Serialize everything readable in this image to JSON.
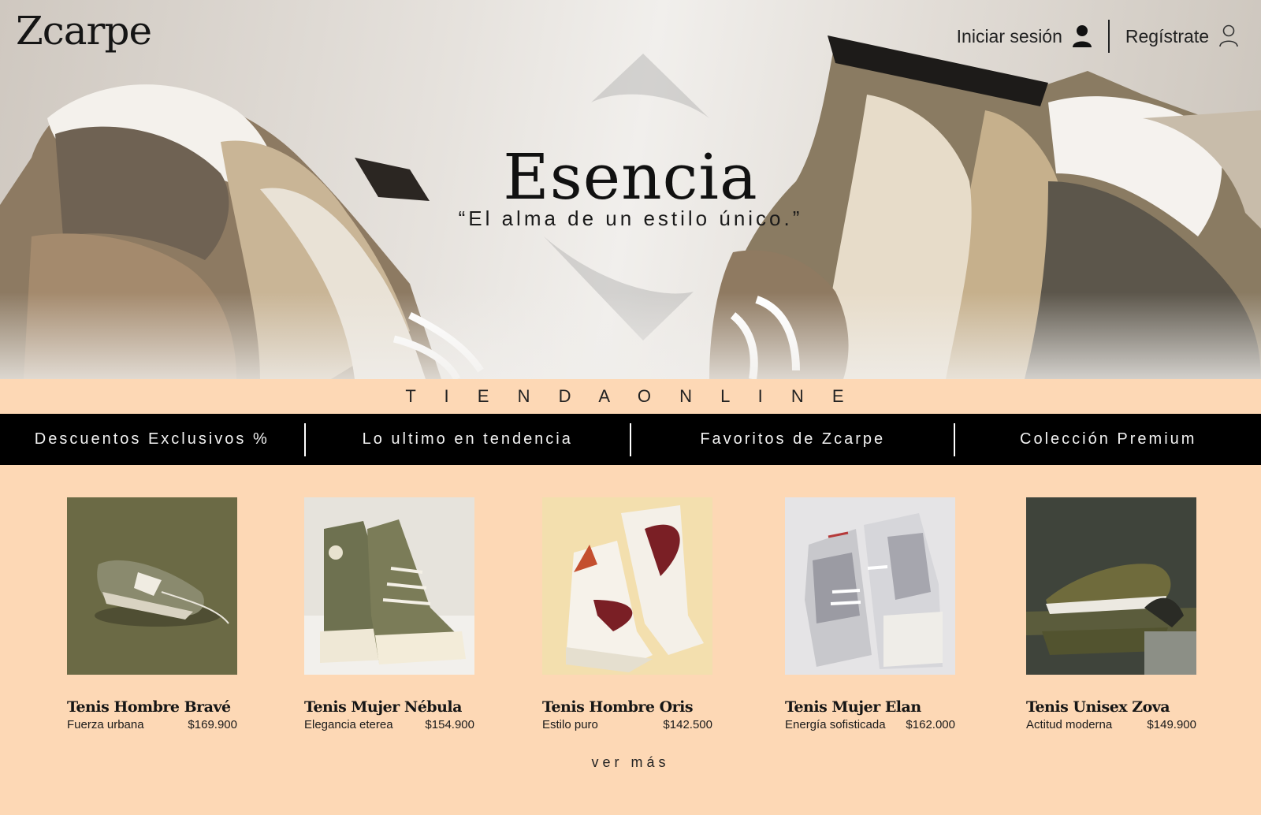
{
  "brand": {
    "logo": "Zcarpe"
  },
  "auth": {
    "login_label": "Iniciar sesión",
    "register_label": "Regístrate"
  },
  "hero": {
    "title": "Esencia",
    "subtitle": "“El alma de un estilo único.”"
  },
  "section_title": "T I E N D A   O N L I N E",
  "nav": {
    "items": [
      {
        "label": "Descuentos Exclusivos %"
      },
      {
        "label": "Lo ultimo en tendencia"
      },
      {
        "label": "Favoritos de Zcarpe"
      },
      {
        "label": "Colección Premium"
      }
    ]
  },
  "products": [
    {
      "name": "Tenis Hombre Bravé",
      "tagline": "Fuerza urbana",
      "price": "$169.900"
    },
    {
      "name": "Tenis Mujer Nébula",
      "tagline": "Elegancia eterea",
      "price": "$154.900"
    },
    {
      "name": "Tenis Hombre Oris",
      "tagline": "Estilo puro",
      "price": "$142.500"
    },
    {
      "name": "Tenis Mujer Elan",
      "tagline": "Energía sofisticada",
      "price": "$162.000"
    },
    {
      "name": "Tenis Unisex Zova",
      "tagline": "Actitud moderna",
      "price": "$149.900"
    }
  ],
  "ver_mas": "ver más",
  "colors": {
    "page_bg": "#fdd8b5",
    "nav_bg": "#000000",
    "nav_text": "#f2f2f2",
    "text": "#1a1a1a"
  }
}
